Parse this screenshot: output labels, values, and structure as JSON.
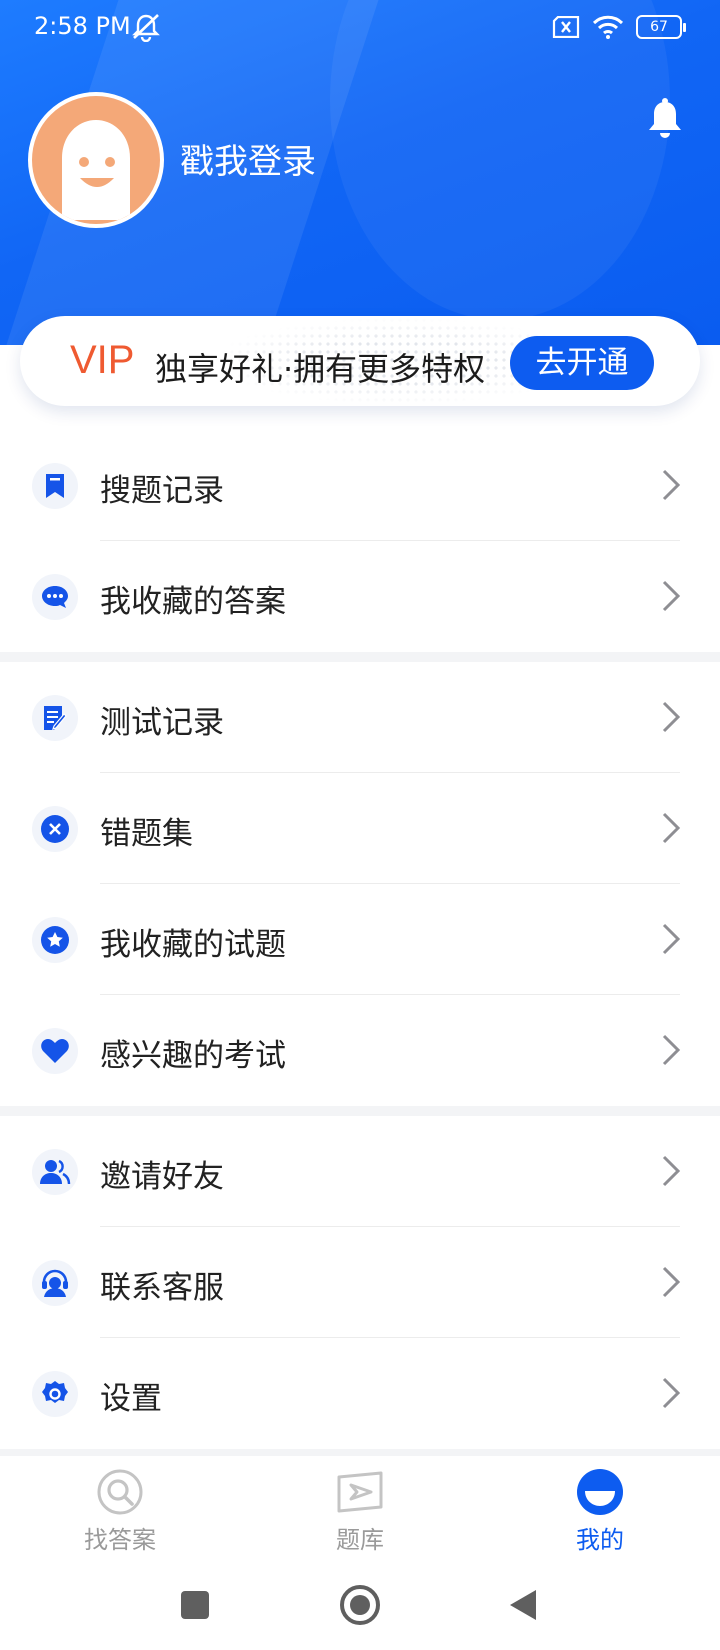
{
  "status_bar": {
    "time": "2:58 PM",
    "battery": "67"
  },
  "header": {
    "login_prompt": "戳我登录"
  },
  "vip": {
    "badge": "VIP",
    "description": "独享好礼·拥有更多特权",
    "button": "去开通"
  },
  "menu_groups": [
    [
      {
        "label": "搜题记录",
        "icon": "bookmark-icon"
      },
      {
        "label": "我收藏的答案",
        "icon": "chat-bubble-icon"
      }
    ],
    [
      {
        "label": "测试记录",
        "icon": "document-edit-icon"
      },
      {
        "label": "错题集",
        "icon": "close-circle-icon"
      },
      {
        "label": "我收藏的试题",
        "icon": "star-circle-icon"
      },
      {
        "label": "感兴趣的考试",
        "icon": "heart-icon"
      }
    ],
    [
      {
        "label": "邀请好友",
        "icon": "users-icon"
      },
      {
        "label": "联系客服",
        "icon": "customer-service-icon"
      },
      {
        "label": "设置",
        "icon": "gear-icon"
      }
    ]
  ],
  "bottom_nav": [
    {
      "label": "找答案",
      "icon": "search-icon",
      "active": false
    },
    {
      "label": "题库",
      "icon": "question-bank-icon",
      "active": false
    },
    {
      "label": "我的",
      "icon": "profile-icon",
      "active": true
    }
  ],
  "colors": {
    "primary": "#0d5cf0",
    "vip_accent": "#ef5a31",
    "icon_blue": "#1554e8"
  }
}
